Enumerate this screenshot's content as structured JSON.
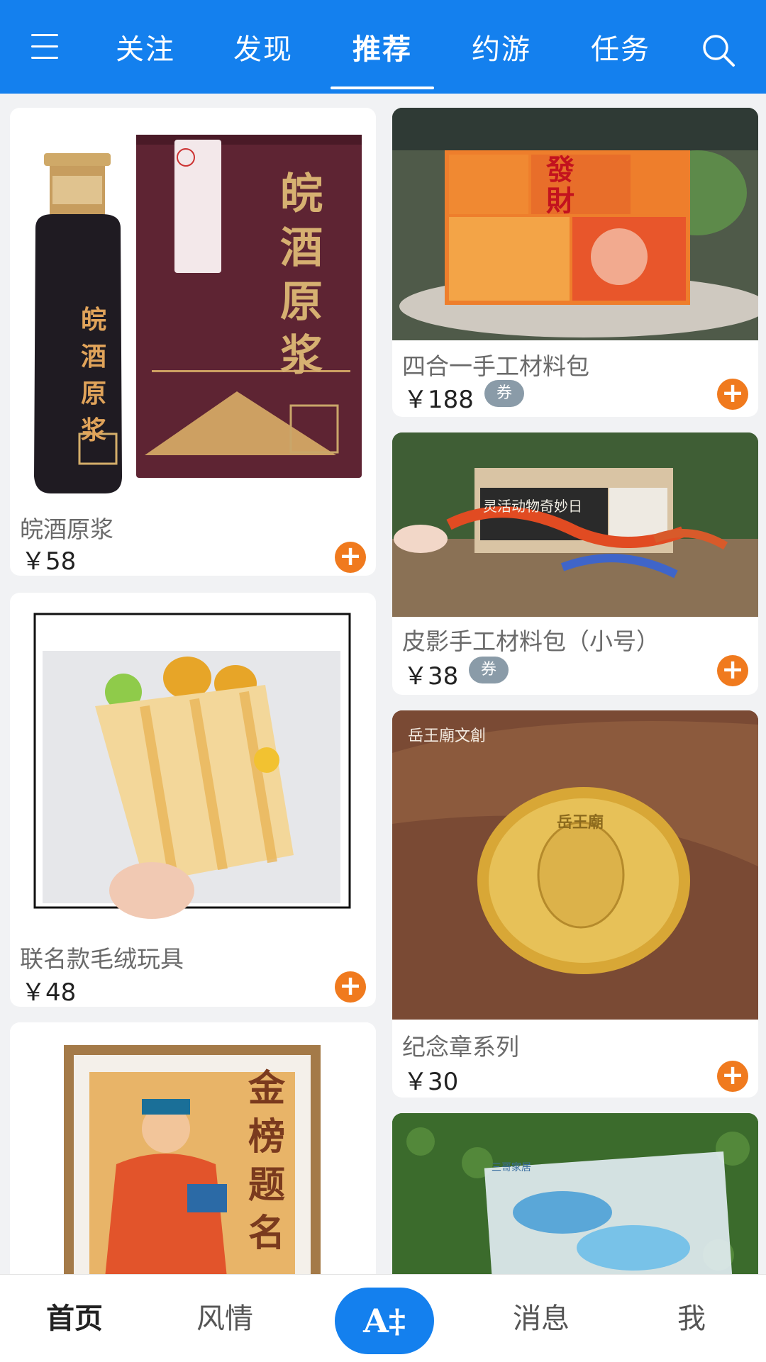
{
  "top_nav": {
    "tabs": [
      {
        "label": "关注"
      },
      {
        "label": "发现"
      },
      {
        "label": "推荐"
      },
      {
        "label": "约游"
      },
      {
        "label": "任务"
      }
    ],
    "active_tab": "推荐",
    "menu_icon": "menu-icon",
    "search_icon": "search-icon"
  },
  "products": [
    {
      "name": "皖酒原浆",
      "price": "￥58",
      "coupon": "",
      "image_text": [
        "皖",
        "酒",
        "原",
        "浆"
      ]
    },
    {
      "name": "四合一手工材料包",
      "price": "￥188",
      "coupon": "券",
      "image_text": [
        "發",
        "財"
      ]
    },
    {
      "name": "皮影手工材料包（小号）",
      "price": "￥38",
      "coupon": "券",
      "image_text": [
        "灵活动物奇妙日"
      ]
    },
    {
      "name": "联名款毛绒玩具",
      "price": "￥48",
      "coupon": ""
    },
    {
      "name": "纪念章系列",
      "price": "￥30",
      "coupon": "",
      "image_text": [
        "岳王廟文創",
        "岳王廟"
      ]
    },
    {
      "name": "",
      "price": "",
      "coupon": "",
      "image_text": [
        "金",
        "榜",
        "题",
        "名"
      ]
    },
    {
      "name": "",
      "price": "",
      "coupon": "",
      "image_text": [
        "三哥家居"
      ]
    }
  ],
  "add_icon": "plus-circle-icon",
  "bottom_nav": {
    "items": [
      {
        "label": "首页"
      },
      {
        "label": "风情"
      },
      {
        "label": "A‡"
      },
      {
        "label": "消息"
      },
      {
        "label": "我"
      }
    ],
    "active": "首页"
  },
  "colors": {
    "brand_blue": "#1480ee",
    "add_orange": "#f07a1e",
    "coupon_gray": "#8a9ba8",
    "page_bg": "#f1f2f4"
  }
}
